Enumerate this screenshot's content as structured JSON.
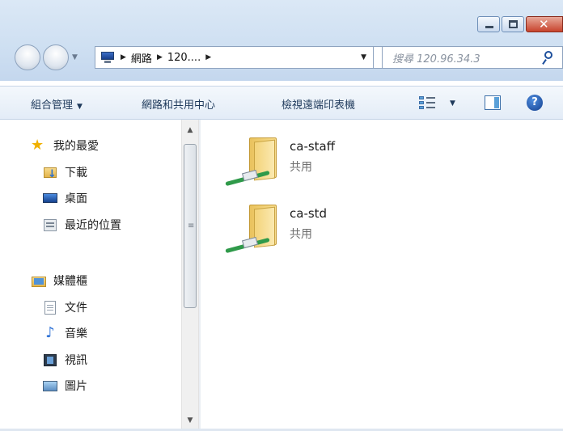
{
  "address": {
    "crumbs": [
      "網路",
      "120...."
    ]
  },
  "search": {
    "placeholder": "搜尋 120.96.34.3"
  },
  "toolbar": {
    "organize": "組合管理",
    "network_center": "網路和共用中心",
    "printers": "檢視遠端印表機"
  },
  "sidebar": {
    "favorites": "我的最愛",
    "downloads": "下載",
    "desktop": "桌面",
    "recent": "最近的位置",
    "libraries": "媒體櫃",
    "documents": "文件",
    "music": "音樂",
    "videos": "視訊",
    "pictures": "圖片"
  },
  "shares": [
    {
      "name": "ca-staff",
      "type": "共用"
    },
    {
      "name": "ca-std",
      "type": "共用"
    }
  ],
  "colors": {
    "accent": "#2a62b8",
    "share_cable": "#2f9a4a"
  }
}
